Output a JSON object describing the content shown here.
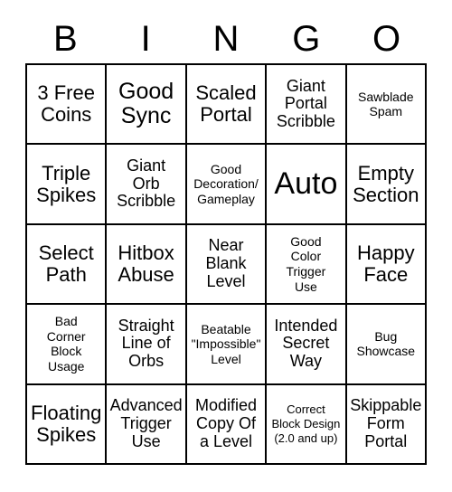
{
  "card": {
    "title": "BINGO",
    "header_letters": [
      "B",
      "I",
      "N",
      "G",
      "O"
    ],
    "grid_size": "5x5",
    "colors": {
      "background": "#ffffff",
      "border": "#000000",
      "text": "#000000"
    },
    "rows": [
      [
        {
          "text": "3 Free\nCoins",
          "size": "md"
        },
        {
          "text": "Good\nSync",
          "size": "lg"
        },
        {
          "text": "Scaled\nPortal",
          "size": "md"
        },
        {
          "text": "Giant\nPortal\nScribble",
          "size": "sm"
        },
        {
          "text": "Sawblade\nSpam",
          "size": "xs"
        }
      ],
      [
        {
          "text": "Triple\nSpikes",
          "size": "md"
        },
        {
          "text": "Giant\nOrb\nScribble",
          "size": "sm"
        },
        {
          "text": "Good\nDecoration/\nGameplay",
          "size": "xs"
        },
        {
          "text": "Auto",
          "size": "xl"
        },
        {
          "text": "Empty\nSection",
          "size": "md"
        }
      ],
      [
        {
          "text": "Select\nPath",
          "size": "md"
        },
        {
          "text": "Hitbox\nAbuse",
          "size": "md"
        },
        {
          "text": "Near\nBlank\nLevel",
          "size": "sm"
        },
        {
          "text": "Good\nColor\nTrigger\nUse",
          "size": "xs"
        },
        {
          "text": "Happy\nFace",
          "size": "md"
        }
      ],
      [
        {
          "text": "Bad\nCorner\nBlock\nUsage",
          "size": "xs"
        },
        {
          "text": "Straight\nLine of\nOrbs",
          "size": "sm"
        },
        {
          "text": "Beatable\n\"Impossible\"\nLevel",
          "size": "xs"
        },
        {
          "text": "Intended\nSecret\nWay",
          "size": "sm"
        },
        {
          "text": "Bug\nShowcase",
          "size": "xs"
        }
      ],
      [
        {
          "text": "Floating\nSpikes",
          "size": "md"
        },
        {
          "text": "Advanced\nTrigger\nUse",
          "size": "sm"
        },
        {
          "text": "Modified\nCopy Of\na Level",
          "size": "sm"
        },
        {
          "text": "Correct\nBlock Design\n(2.0 and up)",
          "size": "xxs"
        },
        {
          "text": "Skippable\nForm\nPortal",
          "size": "sm"
        }
      ]
    ]
  }
}
